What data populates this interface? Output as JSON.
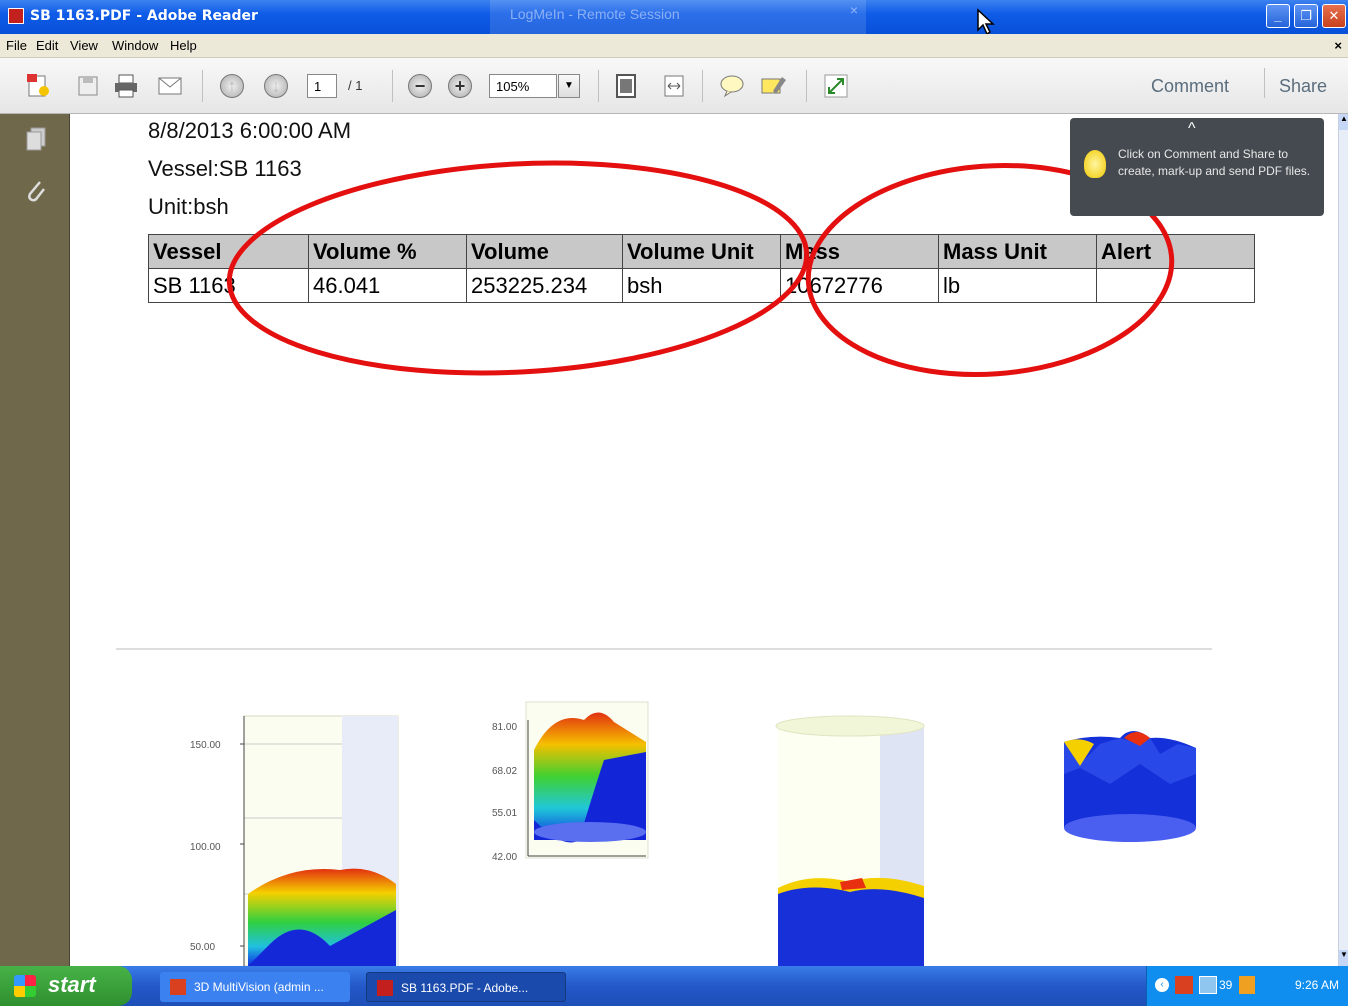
{
  "window": {
    "title": "SB 1163.PDF - Adobe Reader",
    "remote_session": "LogMeIn - Remote Session",
    "remote_close": "×",
    "buttons": {
      "minimize": "_",
      "restore": "❐",
      "close": "✕"
    }
  },
  "menu": {
    "items": [
      "File",
      "Edit",
      "View",
      "Window",
      "Help"
    ],
    "close": "×"
  },
  "toolbar": {
    "page_current": "1",
    "page_total": "/ 1",
    "zoom": "105%",
    "comment_label": "Comment",
    "share_label": "Share",
    "icons": [
      "create-pdf-icon",
      "save-icon",
      "print-icon",
      "email-icon",
      "previous-page-icon",
      "next-page-icon",
      "zoom-out-icon",
      "zoom-in-icon",
      "fit-page-icon",
      "fit-width-icon",
      "sticky-note-icon",
      "highlight-icon",
      "full-screen-icon"
    ]
  },
  "navpane": {
    "icons": [
      "pages-icon",
      "attachments-icon"
    ]
  },
  "callout": {
    "text": "Click on Comment and Share to create, mark-up and send PDF files.",
    "chevron": "^"
  },
  "document": {
    "datetime": "8/8/2013 6:00:00 AM",
    "vessel_line": "Vessel:SB 1163",
    "unit_line": "Unit:bsh",
    "table": {
      "headers": [
        "Vessel",
        "Volume %",
        "Volume",
        "Volume Unit",
        "Mass",
        "Mass Unit",
        "Alert"
      ],
      "rows": [
        [
          "SB 1163",
          "46.041",
          "253225.234",
          "bsh",
          "10672776",
          "lb",
          ""
        ]
      ]
    },
    "charts": [
      {
        "name": "chart-1",
        "y_ticks": [
          "150.00",
          "100.00",
          "50.00"
        ]
      },
      {
        "name": "chart-2",
        "y_ticks": [
          "81.00",
          "68.02",
          "55.01",
          "42.00"
        ]
      },
      {
        "name": "chart-3",
        "y_ticks": []
      },
      {
        "name": "chart-4",
        "y_ticks": []
      }
    ]
  },
  "taskbar": {
    "start_label": "start",
    "tasks": [
      "3D MultiVision (admin ...",
      "SB 1163.PDF - Adobe..."
    ],
    "tray_temp": "39",
    "clock": "9:26 AM"
  },
  "colors": {
    "annotation_red": "#e41010",
    "titlebar_blue": "#0f5ce8",
    "navpane": "#70684a",
    "table_header": "#c8c8c8",
    "callout_bg": "#454a50"
  }
}
